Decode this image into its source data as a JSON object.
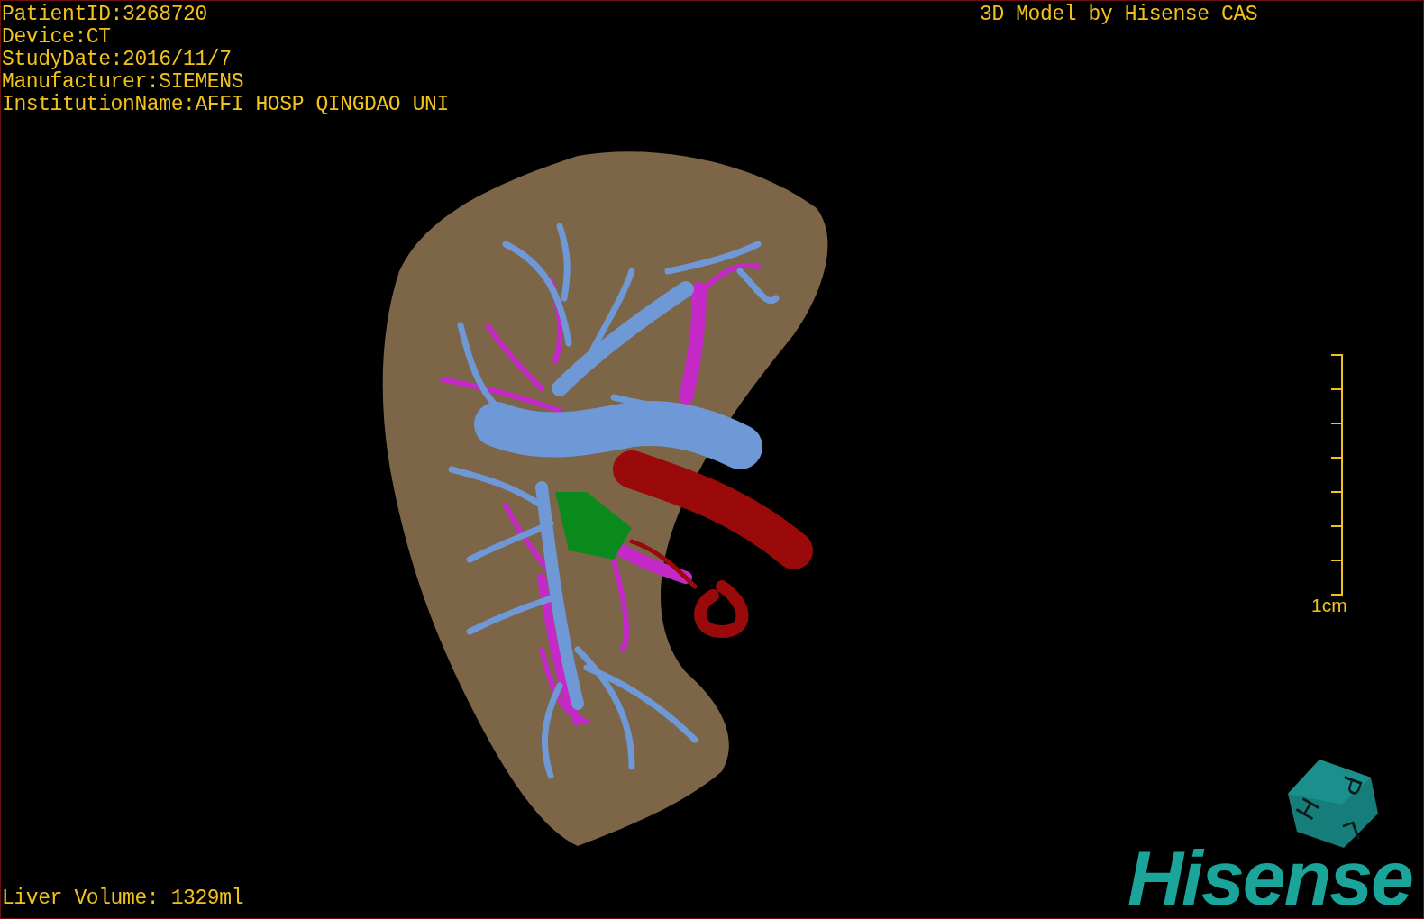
{
  "patient_info": [
    "PatientID:3268720",
    "Device:CT",
    "StudyDate:2016/11/7",
    "Manufacturer:SIEMENS",
    "InstitutionName:AFFI HOSP QINGDAO UNI"
  ],
  "title": "3D Model by Hisense CAS",
  "scale_bar": {
    "label": "1cm"
  },
  "orientation_cube": {
    "labels": [
      "P",
      "H",
      "L"
    ]
  },
  "logo": "Hisense",
  "liver_volume": "Liver Volume: 1329ml"
}
